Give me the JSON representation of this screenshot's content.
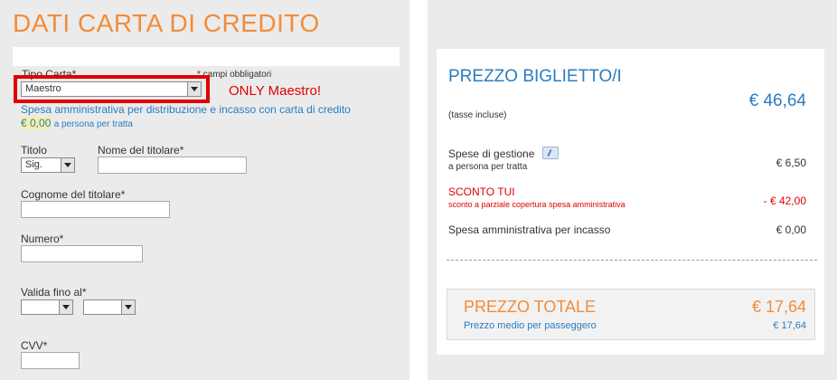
{
  "left": {
    "title": "DATI CARTA DI CREDITO",
    "tipo_carta_label": "Tipo Carta*",
    "required_note": "* campi obbligatori",
    "tipo_carta_value": "Maestro",
    "annotation": "ONLY Maestro!",
    "fee_note": "Spesa amministrativa per distribuzione e incasso con carta di credito",
    "fee_amount": "€ 0,00",
    "fee_suffix": "a persona per tratta",
    "titolo_label": "Titolo",
    "titolo_value": "Sig.",
    "nome_label": "Nome del titolare*",
    "cognome_label": "Cognome del titolare*",
    "numero_label": "Numero*",
    "valida_label": "Valida fino al*",
    "cvv_label": "CVV*"
  },
  "right": {
    "price_title": "PREZZO BIGLIETTO/I",
    "price_value": "€ 46,64",
    "taxes_note": "(tasse incluse)",
    "gestione_label": "Spese di gestione",
    "gestione_sub": "a persona per tratta",
    "gestione_value": "€ 6,50",
    "sconto_label": "SCONTO TUI",
    "sconto_sub": "sconto a parziale copertura spesa amministrativa",
    "sconto_value": "- € 42,00",
    "incasso_label": "Spesa amministrativa per incasso",
    "incasso_value": "€ 0,00",
    "total_label": "PREZZO TOTALE",
    "total_value": "€ 17,64",
    "avg_label": "Prezzo medio per passeggero",
    "avg_value": "€ 17,64"
  },
  "colors": {
    "orange": "#f28c3a",
    "blue": "#2a7dc1",
    "red": "#e00000"
  }
}
